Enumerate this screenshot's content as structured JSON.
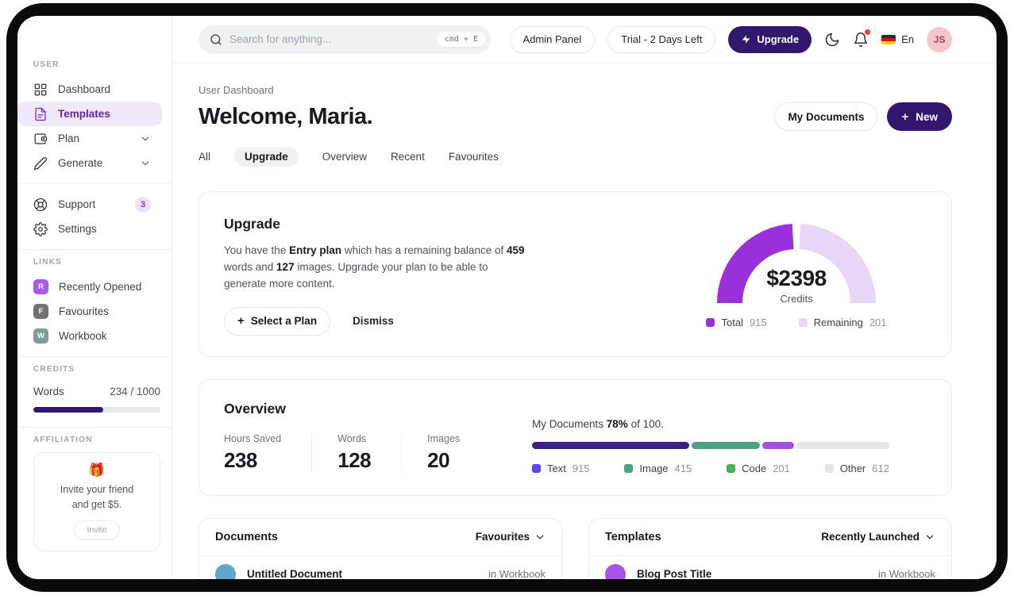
{
  "topbar": {
    "search": {
      "placeholder": "Search for anything...",
      "shortcut": "cmd + E"
    },
    "admin_panel_label": "Admin Panel",
    "trial_label": "Trial - 2 Days Left",
    "upgrade_label": "Upgrade",
    "language_label": "En",
    "avatar_initials": "JS"
  },
  "sidebar": {
    "sections": {
      "user": "USER",
      "links": "LINKS",
      "credits": "CREDITS",
      "affiliation": "AFFILIATION"
    },
    "nav": [
      {
        "label": "Dashboard",
        "icon": "grid-icon"
      },
      {
        "label": "Templates",
        "icon": "file-text-icon"
      },
      {
        "label": "Plan",
        "icon": "wallet-icon"
      },
      {
        "label": "Generate",
        "icon": "pencil-icon"
      }
    ],
    "support_label": "Support",
    "support_badge": "3",
    "settings_label": "Settings",
    "links": [
      {
        "initial": "R",
        "label": "Recently Opened",
        "color": "#a85ce8"
      },
      {
        "initial": "F",
        "label": "Favourites",
        "color": "#71717a"
      },
      {
        "initial": "W",
        "label": "Workbook",
        "color": "#7d9c94"
      }
    ],
    "credits": {
      "label": "Words",
      "value": "234 / 1000",
      "percent": 55
    },
    "affiliation": {
      "emoji": "🎁",
      "line1": "Invite your friend",
      "line2": "and get $5.",
      "button_label": "Invite"
    }
  },
  "header": {
    "breadcrumb": "User Dashboard",
    "title": "Welcome, Maria.",
    "my_documents_label": "My Documents",
    "new_label": "New",
    "plus": "+"
  },
  "tabs": [
    {
      "label": "All"
    },
    {
      "label": "Upgrade"
    },
    {
      "label": "Overview"
    },
    {
      "label": "Recent"
    },
    {
      "label": "Favourites"
    }
  ],
  "upgrade_card": {
    "title": "Upgrade",
    "description": {
      "p1": "You have the ",
      "b1": "Entry plan",
      "p2": " which has a remaining balance of ",
      "b2": "459",
      "p3": " words and ",
      "b3": "127",
      "p4": " images. Upgrade your plan to be able to generate more content."
    },
    "plus": "+",
    "select_plan_label": "Select a Plan",
    "dismiss_label": "Dismiss",
    "gauge": {
      "type": "semi-donut",
      "value": "$2398",
      "label": "Credits",
      "legend": [
        {
          "name": "Total",
          "value": "915",
          "color": "#9a30da"
        },
        {
          "name": "Remaining",
          "value": "201",
          "color": "#e7d7f6"
        }
      ]
    }
  },
  "overview_card": {
    "title": "Overview",
    "stats": [
      {
        "label": "Hours Saved",
        "value": "238"
      },
      {
        "label": "Words",
        "value": "128"
      },
      {
        "label": "Images",
        "value": "20"
      }
    ],
    "progress": {
      "prefix": "My Documents ",
      "bold": "78%",
      "suffix": " of 100.",
      "segments": [
        {
          "name": "Text",
          "value": "915",
          "percent": 44,
          "bar_color": "#3a2284",
          "legend_color": "#6246e5"
        },
        {
          "name": "Image",
          "value": "415",
          "percent": 19,
          "bar_color": "#4d9f85",
          "legend_color": "#4d9f85"
        },
        {
          "name": "Code",
          "value": "201",
          "percent": 9,
          "bar_color": "#a44fe2",
          "legend_color": "#4cb04f"
        },
        {
          "name": "Other",
          "value": "612",
          "percent": 28,
          "bar_color": "#e6e6e9",
          "legend_color": "#e4e4e7"
        }
      ]
    }
  },
  "documents_card": {
    "title": "Documents",
    "filter_label": "Favourites",
    "rows": [
      {
        "title": "Untitled Document",
        "location": "in Workbook",
        "avatar_color": "#5fa8cc"
      }
    ]
  },
  "templates_card": {
    "title": "Templates",
    "filter_label": "Recently Launched",
    "rows": [
      {
        "title": "Blog Post Title",
        "location": "in Workbook",
        "avatar_color": "#a556e8"
      }
    ]
  },
  "colors": {
    "accent": "#31186e",
    "active_nav_bg": "#f0e9fa",
    "active_nav_text": "#5f23b8",
    "notification_dot": "#e8442e"
  }
}
